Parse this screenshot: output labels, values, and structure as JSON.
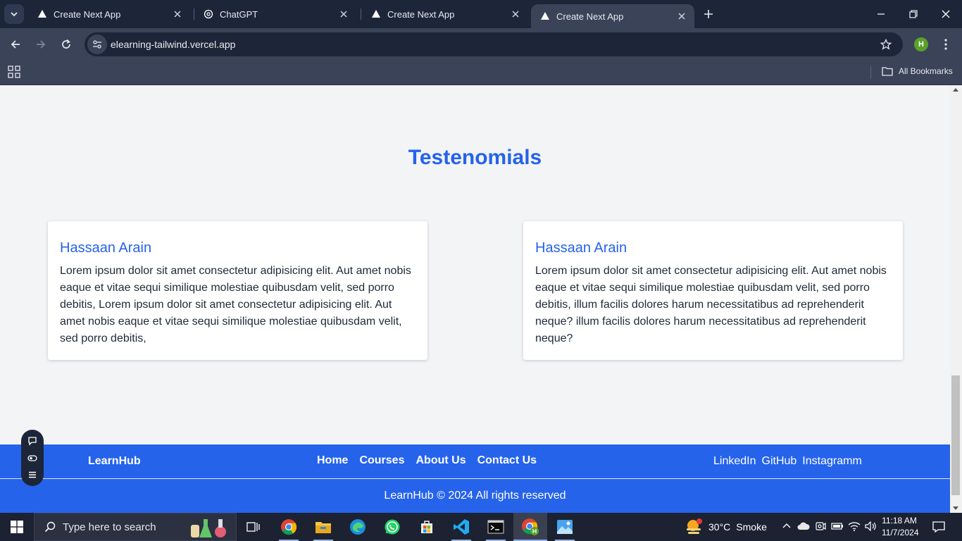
{
  "browser": {
    "tabs": [
      {
        "title": "Create Next App",
        "active": false
      },
      {
        "title": "ChatGPT",
        "active": false
      },
      {
        "title": "Create Next App",
        "active": false
      },
      {
        "title": "Create Next App",
        "active": true
      }
    ],
    "url": "elearning-tailwind.vercel.app",
    "profile_initial": "H",
    "bookmarks_label": "All Bookmarks"
  },
  "page": {
    "section_title": "Testenomials",
    "testimonials": [
      {
        "name": "Hassaan Arain",
        "text": "Lorem ipsum dolor sit amet consectetur adipisicing elit. Aut amet nobis eaque et vitae sequi similique molestiae quibusdam velit, sed porro debitis, Lorem ipsum dolor sit amet consectetur adipisicing elit. Aut amet nobis eaque et vitae sequi similique molestiae quibusdam velit, sed porro debitis,"
      },
      {
        "name": "Hassaan Arain",
        "text": "Lorem ipsum dolor sit amet consectetur adipisicing elit. Aut amet nobis eaque et vitae sequi similique molestiae quibusdam velit, sed porro debitis, illum facilis dolores harum necessitatibus ad reprehenderit neque? illum facilis dolores harum necessitatibus ad reprehenderit neque?"
      }
    ],
    "footer": {
      "brand": "LearnHub",
      "nav": [
        "Home",
        "Courses",
        "About Us",
        "Contact Us"
      ],
      "social": [
        "LinkedIn",
        "GitHub",
        "Instagramm"
      ],
      "copyright": "LearnHub © 2024 All rights reserved"
    }
  },
  "taskbar": {
    "search_placeholder": "Type here to search",
    "weather": {
      "temp": "30°C",
      "condition": "Smoke"
    },
    "time": "11:18 AM",
    "date": "11/7/2024"
  },
  "colors": {
    "accent": "#2563eb",
    "tab_bar": "#1d2639",
    "toolbar": "#3a4358",
    "page_bg": "#f3f4f6"
  }
}
